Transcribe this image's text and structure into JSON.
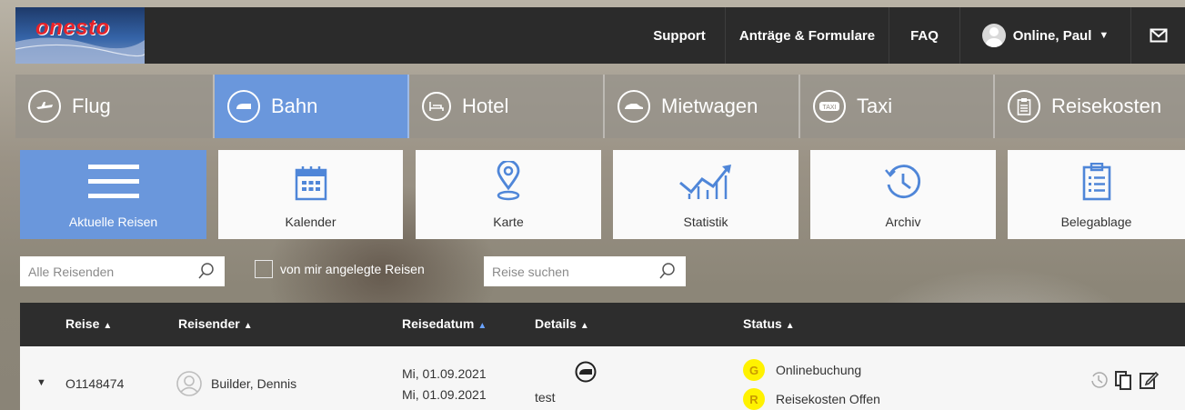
{
  "app": {
    "logo_text": "onesto"
  },
  "topnav": {
    "support": "Support",
    "forms": "Anträge & Formulare",
    "faq": "FAQ",
    "user": "Online, Paul"
  },
  "modes": [
    {
      "label": "Flug",
      "icon": "plane-icon",
      "active": false
    },
    {
      "label": "Bahn",
      "icon": "train-icon",
      "active": true
    },
    {
      "label": "Hotel",
      "icon": "bed-icon",
      "active": false
    },
    {
      "label": "Mietwagen",
      "icon": "car-icon",
      "active": false
    },
    {
      "label": "Taxi",
      "icon": "taxi-icon",
      "active": false
    },
    {
      "label": "Reisekosten",
      "icon": "clipboard-icon",
      "active": false
    }
  ],
  "tiles": [
    {
      "label": "Aktuelle Reisen",
      "icon": "menu-icon",
      "active": true
    },
    {
      "label": "Kalender",
      "icon": "calendar-icon",
      "active": false
    },
    {
      "label": "Karte",
      "icon": "map-pin-icon",
      "active": false
    },
    {
      "label": "Statistik",
      "icon": "chart-icon",
      "active": false
    },
    {
      "label": "Archiv",
      "icon": "history-icon",
      "active": false
    },
    {
      "label": "Belegablage",
      "icon": "document-list-icon",
      "active": false
    }
  ],
  "filters": {
    "traveler_placeholder": "Alle Reisenden",
    "own_trips_label": "von mir angelegte Reisen",
    "own_trips_checked": false,
    "search_placeholder": "Reise suchen"
  },
  "table": {
    "headers": {
      "trip": "Reise",
      "traveler": "Reisender",
      "date": "Reisedatum",
      "details": "Details",
      "status": "Status"
    },
    "sorted_by": "date",
    "rows": [
      {
        "trip_id": "O1148474",
        "traveler": "Builder, Dennis",
        "date_start": "Mi, 01.09.2021",
        "date_end": "Mi, 01.09.2021",
        "details": "test",
        "detail_icon": "train-icon",
        "statuses": [
          {
            "badge": "G",
            "text": "Onlinebuchung"
          },
          {
            "badge": "R",
            "text": "Reisekosten Offen"
          }
        ]
      }
    ]
  },
  "colors": {
    "accent": "#6a97dc",
    "topbar": "#2b2b2b",
    "badge": "#fff200"
  }
}
